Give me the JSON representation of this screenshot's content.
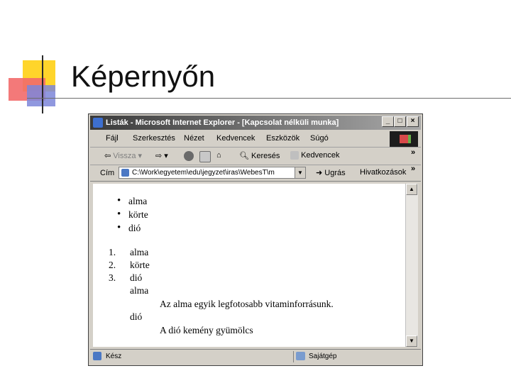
{
  "slide": {
    "title": "Képernyőn"
  },
  "browser": {
    "title": "Listák - Microsoft Internet Explorer - [Kapcsolat nélküli munka]",
    "menu": [
      "Fájl",
      "Szerkesztés",
      "Nézet",
      "Kedvencek",
      "Eszközök",
      "Súgó"
    ],
    "toolbar": {
      "back": "Vissza",
      "search": "Keresés",
      "favorites": "Kedvencek",
      "overflow": "»"
    },
    "address": {
      "label": "Cím",
      "value": "C:\\Work\\egyetem\\edu\\jegyzet\\iras\\WebesT\\m",
      "go": "Ugrás",
      "links": "Hivatkozások",
      "overflow": "»"
    },
    "status": {
      "left": "Kész",
      "right": "Sajátgép"
    }
  },
  "page": {
    "unordered": [
      "alma",
      "körte",
      "dió"
    ],
    "ordered": [
      {
        "num": "1.",
        "text": "alma"
      },
      {
        "num": "2.",
        "text": "körte"
      },
      {
        "num": "3.",
        "text": "dió"
      }
    ],
    "definitions": [
      {
        "term": "alma",
        "desc": "Az alma egyik legfotosabb vitaminforrásunk."
      },
      {
        "term": "dió",
        "desc": "A dió kemény gyümölcs"
      }
    ]
  },
  "colors": {
    "accent_yellow": "#ffd52b",
    "accent_red": "#f26a6a",
    "accent_blue": "#7c86d9"
  }
}
